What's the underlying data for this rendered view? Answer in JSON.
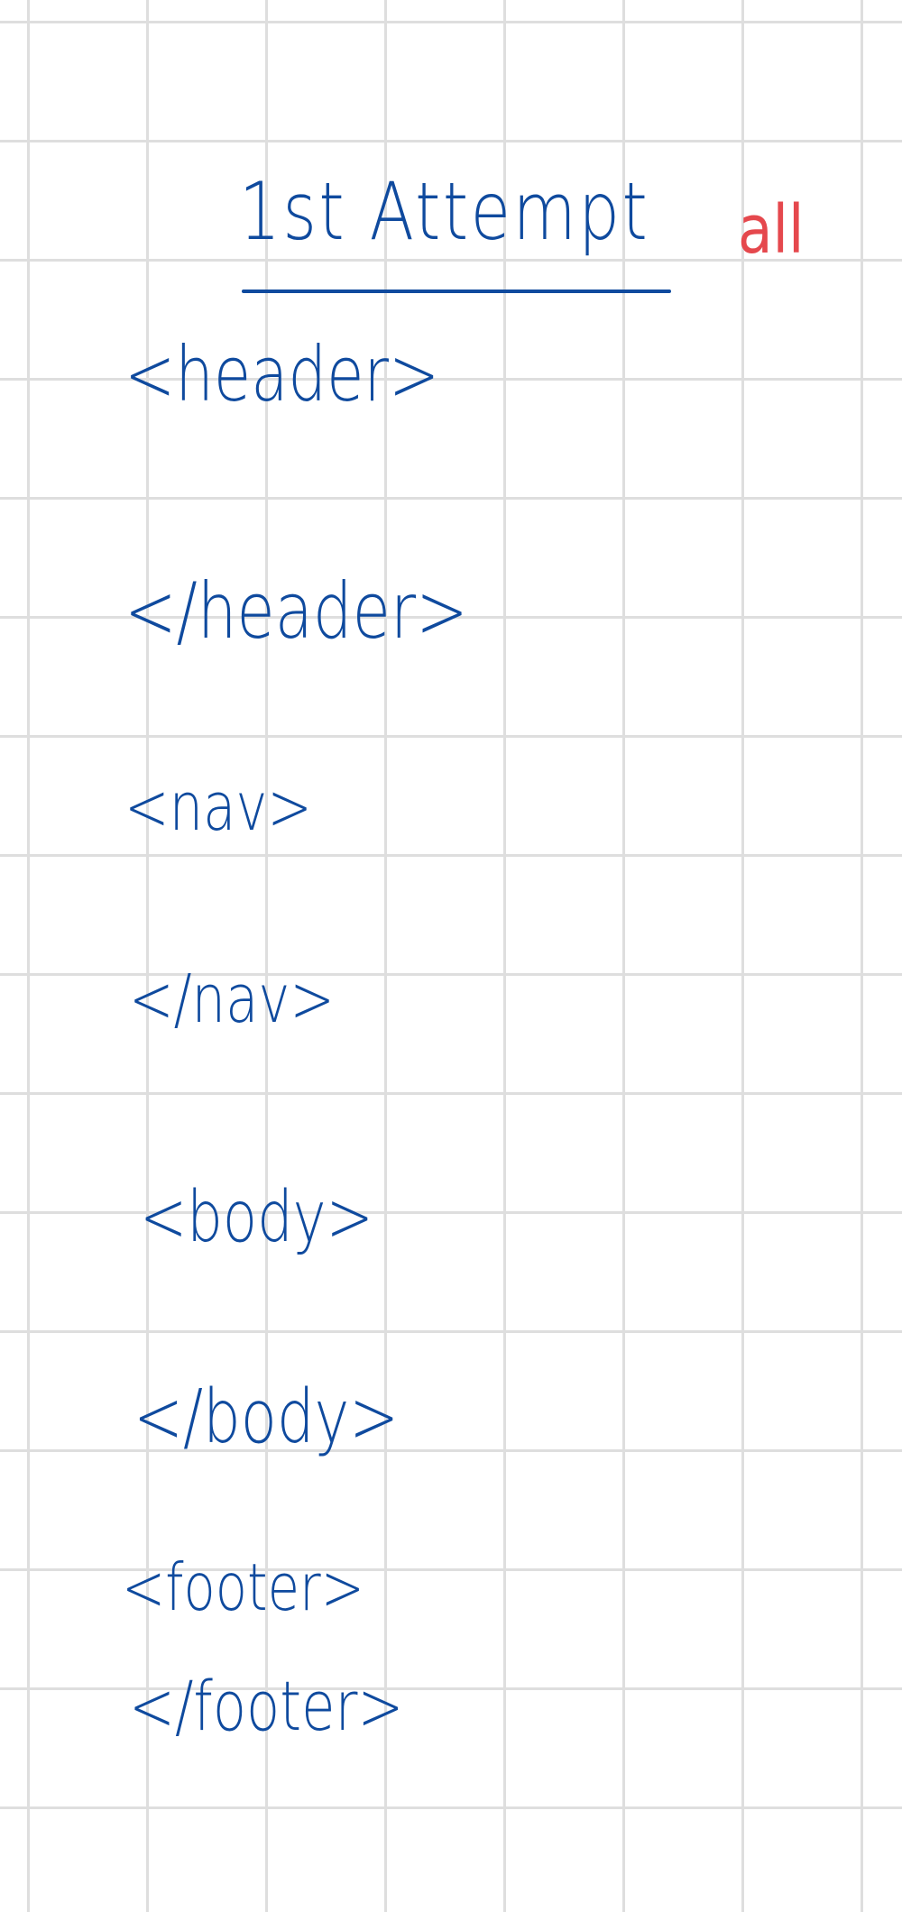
{
  "title": "1st Attempt",
  "note": "all",
  "colors": {
    "ink": "#0f4a9e",
    "note": "#e5484d",
    "grid": "#dedede",
    "paper": "#ffffff"
  },
  "tags": [
    "<header>",
    "</header>",
    "<nav>",
    "</nav>",
    "<body>",
    "</body>",
    "<footer>",
    "</footer>"
  ]
}
